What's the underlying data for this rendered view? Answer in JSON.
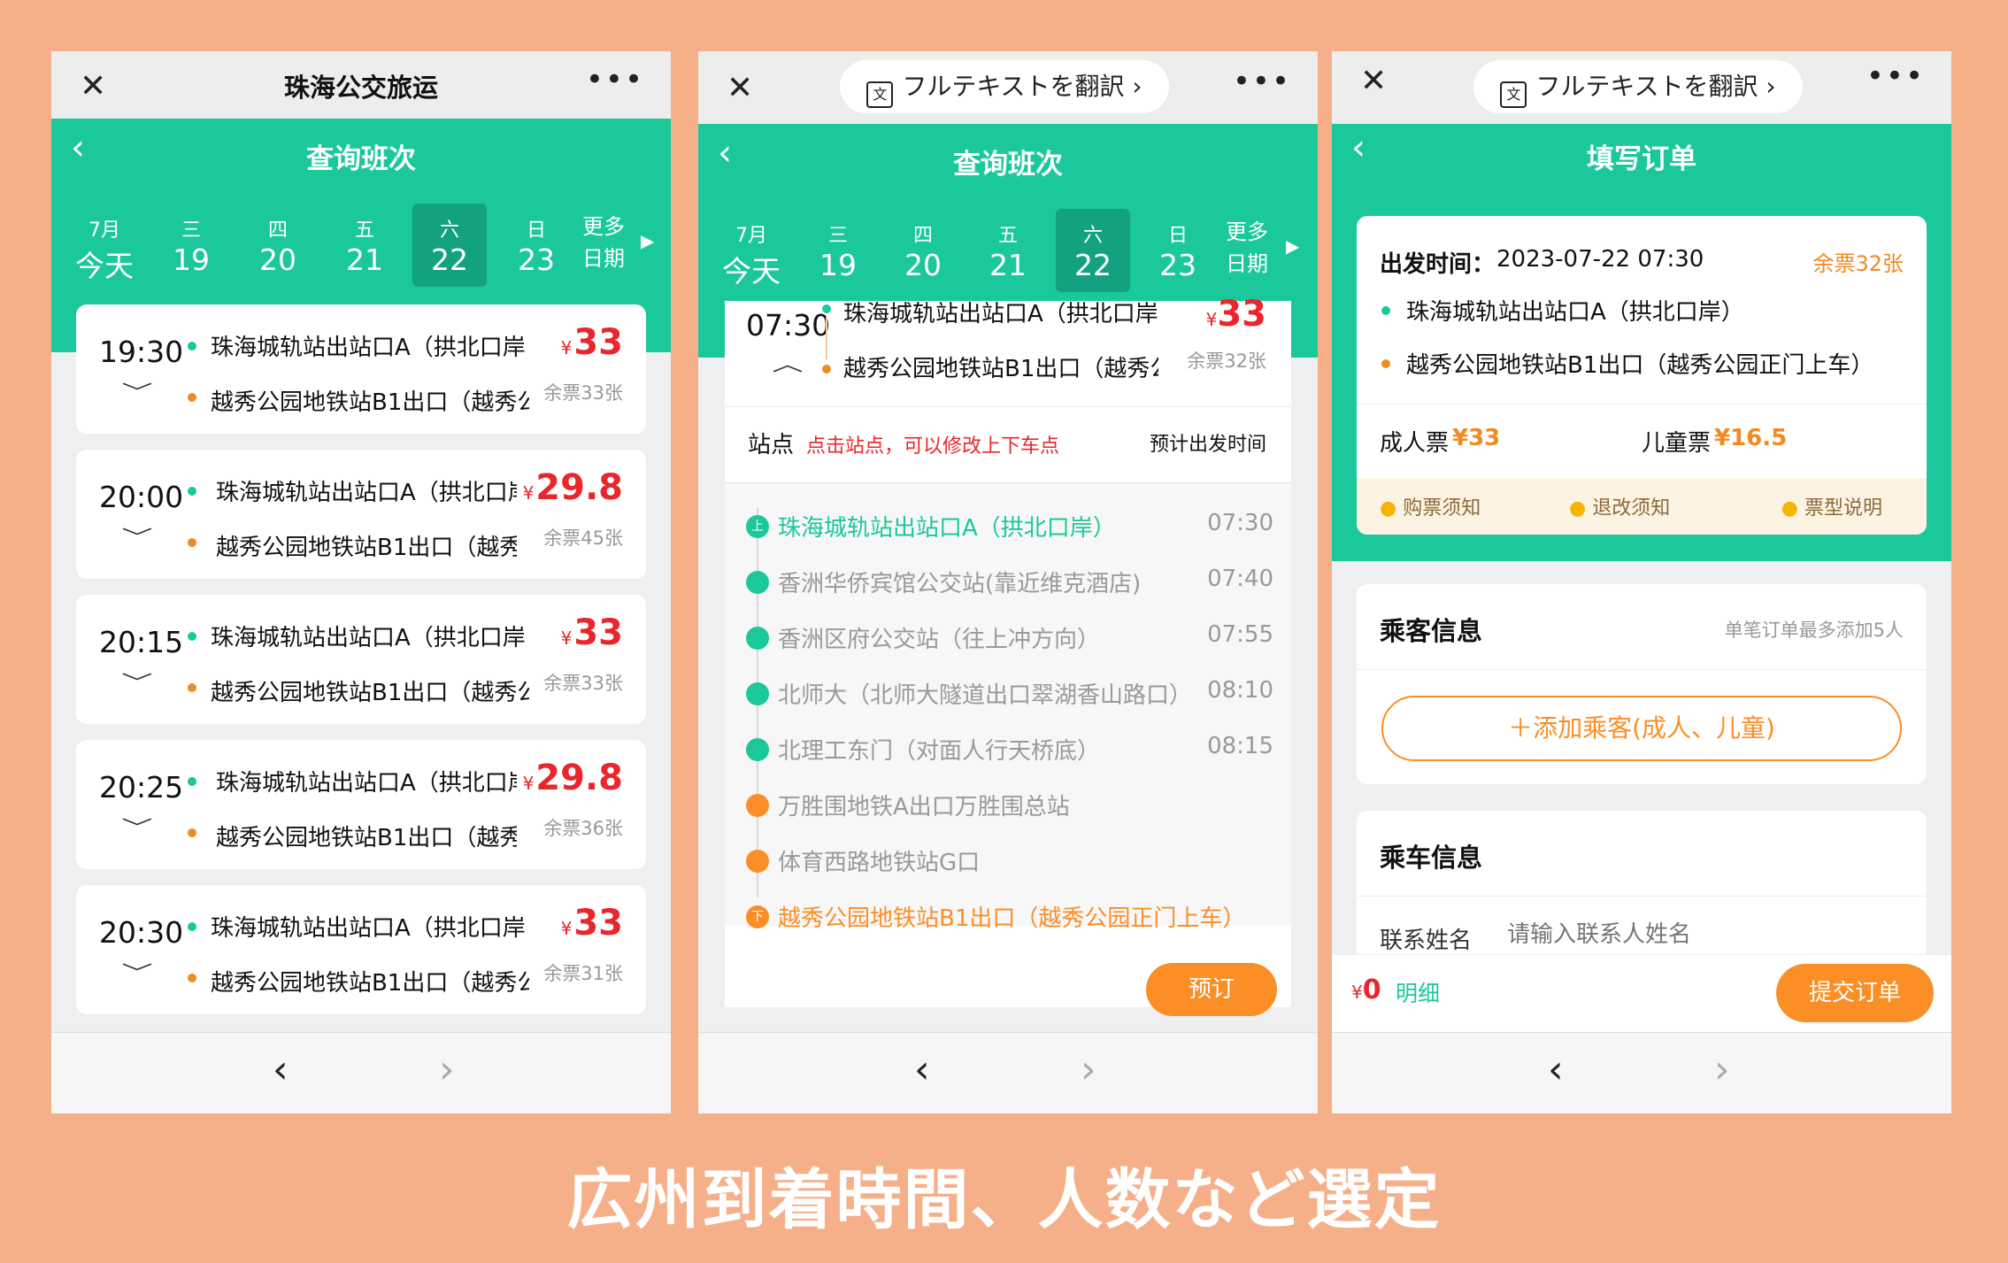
{
  "caption": "広州到着時間、人数など選定",
  "common": {
    "close_icon": "✕",
    "more_icon": "•••",
    "back_icon": "‹",
    "nav_back": "‹",
    "nav_forward": "›",
    "dropdown_icon": "﹀"
  },
  "translate": {
    "label": "フルテキストを翻訳 ›"
  },
  "colors": {
    "accent": "#1bc89c",
    "orange": "#fb8e25",
    "price": "#e8262b",
    "background": "#f5b08a"
  },
  "p1": {
    "window_title": "珠海公交旅运",
    "header_title": "查询班次",
    "dates": [
      {
        "week": "7月",
        "day": "今天"
      },
      {
        "week": "三",
        "day": "19"
      },
      {
        "week": "四",
        "day": "20"
      },
      {
        "week": "五",
        "day": "21"
      },
      {
        "week": "六",
        "day": "22"
      },
      {
        "week": "日",
        "day": "23"
      }
    ],
    "more_dates": {
      "line1": "更多",
      "line2": "日期"
    },
    "trips": [
      {
        "time": "19:30",
        "from": "珠海城轨站出站口A（拱北口岸",
        "to": "越秀公园地铁站B1出口（越秀公",
        "currency": "¥",
        "price": "33",
        "remain": "余票33张"
      },
      {
        "time": "20:00",
        "from": "珠海城轨站出站口A（拱北口岸",
        "to": "越秀公园地铁站B1出口（越秀公",
        "currency": "¥",
        "price": "29.8",
        "remain": "余票45张"
      },
      {
        "time": "20:15",
        "from": "珠海城轨站出站口A（拱北口岸",
        "to": "越秀公园地铁站B1出口（越秀公",
        "currency": "¥",
        "price": "33",
        "remain": "余票33张"
      },
      {
        "time": "20:25",
        "from": "珠海城轨站出站口A（拱北口岸",
        "to": "越秀公园地铁站B1出口（越秀公",
        "currency": "¥",
        "price": "29.8",
        "remain": "余票36张"
      },
      {
        "time": "20:30",
        "from": "珠海城轨站出站口A（拱北口岸",
        "to": "越秀公园地铁站B1出口（越秀公",
        "currency": "¥",
        "price": "33",
        "remain": "余票31张"
      }
    ]
  },
  "p2": {
    "header_title": "查询班次",
    "trip": {
      "time": "07:30",
      "from": "珠海城轨站出站口A（拱北口岸",
      "to": "越秀公园地铁站B1出口（越秀公",
      "currency": "¥",
      "price": "33",
      "remain": "余票32张",
      "collapse_icon": "︿"
    },
    "stops_label": "站点",
    "stops_hint": "点击站点，可以修改上下车点",
    "depart_label": "预计出发时间",
    "board_icon": "上",
    "alight_icon": "下",
    "stops": [
      {
        "name": "珠海城轨站出站口A（拱北口岸）",
        "time": "07:30"
      },
      {
        "name": "香洲华侨宾馆公交站(靠近维克酒店)",
        "time": "07:40"
      },
      {
        "name": "香洲区府公交站（往上冲方向）",
        "time": "07:55"
      },
      {
        "name": "北师大（北师大隧道出口翠湖香山路口）",
        "time": "08:10"
      },
      {
        "name": "北理工东门（对面人行天桥底）",
        "time": "08:15"
      },
      {
        "name": "万胜围地铁A出口万胜围总站",
        "time": ""
      },
      {
        "name": "体育西路地铁站G口",
        "time": ""
      },
      {
        "name": "越秀公园地铁站B1出口（越秀公园正门上车）",
        "time": ""
      }
    ],
    "book_label": "预订"
  },
  "p3": {
    "header_title": "填写订单",
    "depart_label": "出发时间：",
    "depart_value": "2023-07-22 07:30",
    "remain": "余票32张",
    "from": "珠海城轨站出站口A（拱北口岸）",
    "to": "越秀公园地铁站B1出口（越秀公园正门上车）",
    "adult_label": "成人票",
    "adult_price": "¥33",
    "child_label": "儿童票",
    "child_price": "¥16.5",
    "notices": [
      "购票须知",
      "退改须知",
      "票型说明"
    ],
    "passenger_title": "乘客信息",
    "passenger_hint": "单笔订单最多添加5人",
    "add_passenger": "＋添加乘客(成人、儿童)",
    "ride_title": "乘车信息",
    "contact_label": "联系姓名",
    "contact_placeholder": "请输入联系人姓名",
    "total_currency": "¥",
    "total": "0",
    "detail_label": "明细",
    "submit_label": "提交订单"
  }
}
